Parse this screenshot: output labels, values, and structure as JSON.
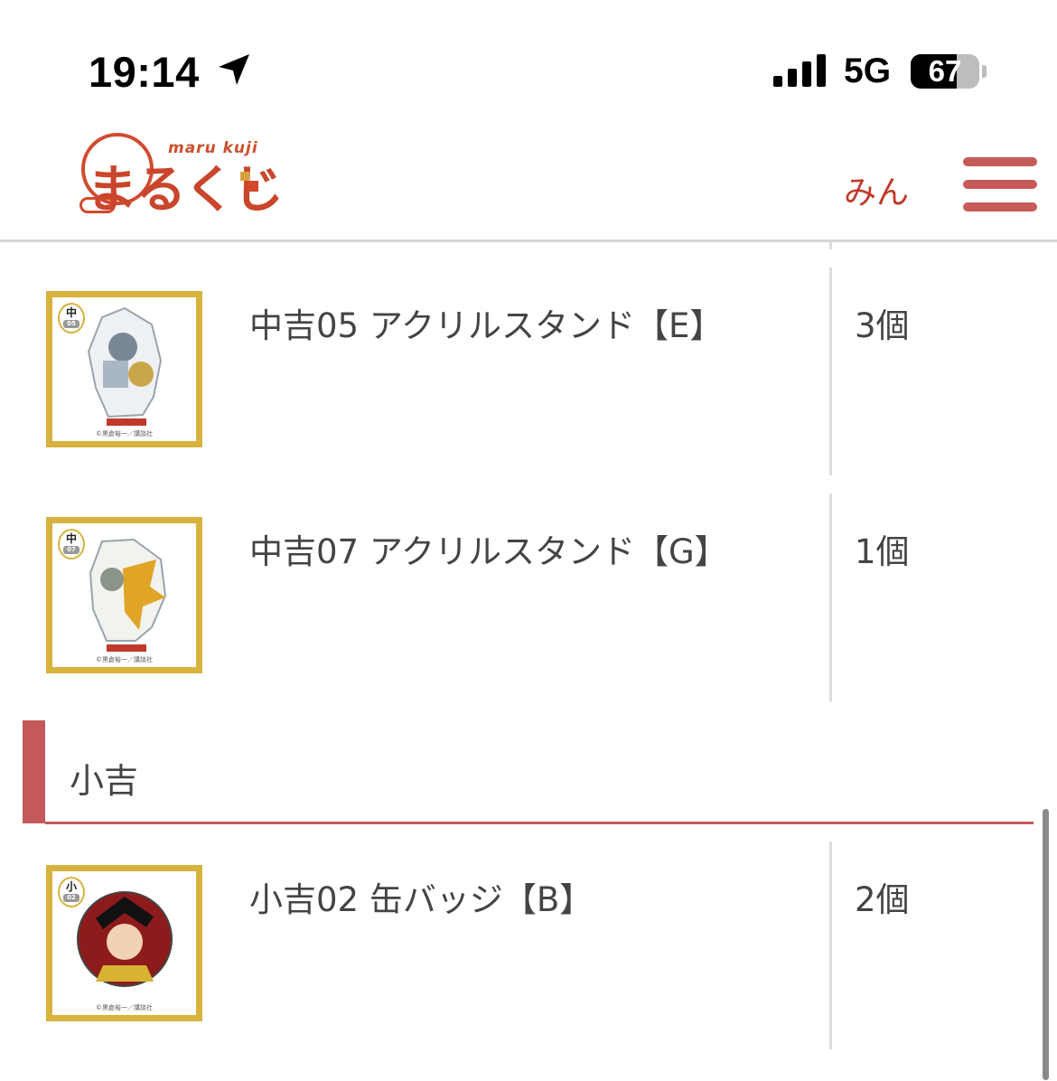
{
  "status_bar": {
    "time": "19:14",
    "network": "5G",
    "battery_percent": 67,
    "battery_text": "67"
  },
  "header": {
    "logo_sub": "maru kuji",
    "logo_main": "まるくじ",
    "user_name": "みん"
  },
  "items_top": [
    {
      "name": "中吉05 アクリルスタンド【E】",
      "qty": "3個",
      "badge_rank": "中",
      "badge_num": "05"
    },
    {
      "name": "中吉07 アクリルスタンド【G】",
      "qty": "1個",
      "badge_rank": "中",
      "badge_num": "07"
    }
  ],
  "section": {
    "title": "小吉"
  },
  "items_bottom": [
    {
      "name": "小吉02 缶バッジ【B】",
      "qty": "2個",
      "badge_rank": "小",
      "badge_num": "02"
    }
  ],
  "thumb_copyright": "©黒倉裕一／講談社",
  "colors": {
    "accent": "#c55959",
    "brand": "#c9452b",
    "frame": "#d7b33d"
  }
}
